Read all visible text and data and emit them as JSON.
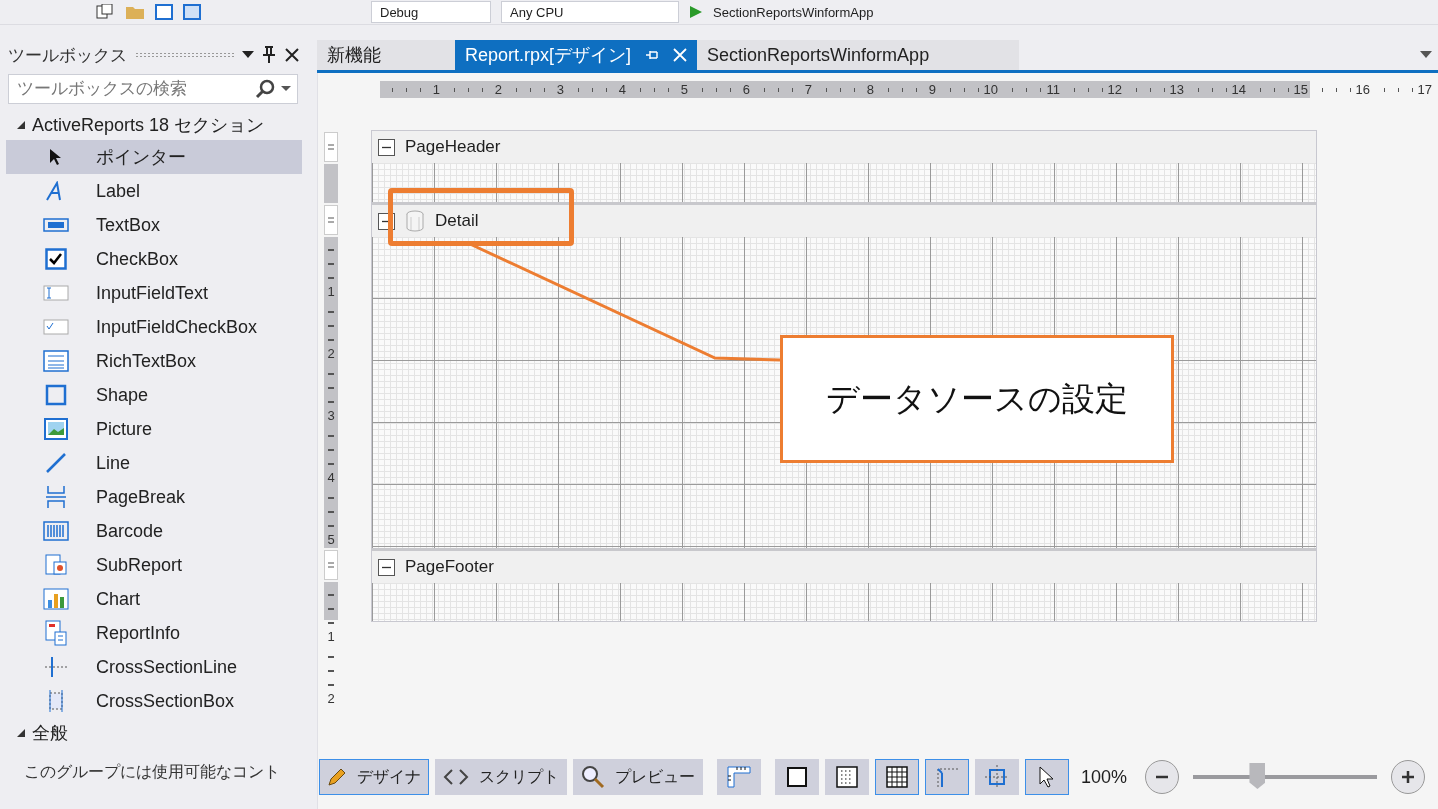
{
  "toolbar": {
    "configuration": "Debug",
    "platform": "Any CPU",
    "startup_project": "SectionReportsWinformApp"
  },
  "toolbox": {
    "title": "ツールボックス",
    "search": {
      "placeholder": "ツールボックスの検索"
    },
    "groups": [
      {
        "label": "ActiveReports 18 セクション",
        "expanded": true,
        "items": [
          {
            "label": "ポインター",
            "kind": "pointer",
            "selected": true
          },
          {
            "label": "Label",
            "kind": "label",
            "selected": false
          },
          {
            "label": "TextBox",
            "kind": "textbox",
            "selected": false
          },
          {
            "label": "CheckBox",
            "kind": "checkbox",
            "selected": false
          },
          {
            "label": "InputFieldText",
            "kind": "inputtext",
            "selected": false
          },
          {
            "label": "InputFieldCheckBox",
            "kind": "inputcheck",
            "selected": false
          },
          {
            "label": "RichTextBox",
            "kind": "richtext",
            "selected": false
          },
          {
            "label": "Shape",
            "kind": "shape",
            "selected": false
          },
          {
            "label": "Picture",
            "kind": "picture",
            "selected": false
          },
          {
            "label": "Line",
            "kind": "line",
            "selected": false
          },
          {
            "label": "PageBreak",
            "kind": "pagebreak",
            "selected": false
          },
          {
            "label": "Barcode",
            "kind": "barcode",
            "selected": false
          },
          {
            "label": "SubReport",
            "kind": "subreport",
            "selected": false
          },
          {
            "label": "Chart",
            "kind": "chart",
            "selected": false
          },
          {
            "label": "ReportInfo",
            "kind": "reportinfo",
            "selected": false
          },
          {
            "label": "CrossSectionLine",
            "kind": "crossline",
            "selected": false
          },
          {
            "label": "CrossSectionBox",
            "kind": "crossbox",
            "selected": false
          }
        ]
      },
      {
        "label": "全般",
        "expanded": true,
        "message": "このグループには使用可能なコント"
      }
    ]
  },
  "tabs": [
    {
      "label": "新機能",
      "selected": false
    },
    {
      "label": "Report.rpx[デザイン]",
      "selected": true
    },
    {
      "label": "SectionReportsWinformApp",
      "selected": false
    }
  ],
  "ruler": [
    "1",
    "2",
    "3",
    "4",
    "5",
    "6",
    "7",
    "8",
    "9",
    "10",
    "11",
    "12",
    "13",
    "14",
    "15",
    "16",
    "17"
  ],
  "sections": [
    {
      "name": "PageHeader",
      "kind": "header",
      "expanded": true
    },
    {
      "name": "Detail",
      "kind": "detail",
      "expanded": true,
      "ruler": [
        "1",
        "2",
        "3",
        "4",
        "5"
      ]
    },
    {
      "name": "PageFooter",
      "kind": "footer",
      "expanded": true,
      "ruler": [
        "1",
        "2"
      ]
    }
  ],
  "callout": {
    "text": "データソースの設定"
  },
  "views": [
    {
      "label": "デザイナ",
      "kind": "designer",
      "selected": true
    },
    {
      "label": "スクリプト",
      "kind": "script",
      "selected": false
    },
    {
      "label": "プレビュー",
      "kind": "preview",
      "selected": false
    }
  ],
  "tools": [
    {
      "kind": "ruler",
      "selected": false
    },
    {
      "kind": "box",
      "selected": false
    },
    {
      "kind": "dots",
      "selected": false
    },
    {
      "kind": "grid",
      "selected": true
    },
    {
      "kind": "snaplines",
      "selected": true
    },
    {
      "kind": "snapgrid",
      "selected": false
    },
    {
      "kind": "pointer",
      "selected": true
    }
  ],
  "zoom": {
    "reading": "100%",
    "level": 0.35
  }
}
